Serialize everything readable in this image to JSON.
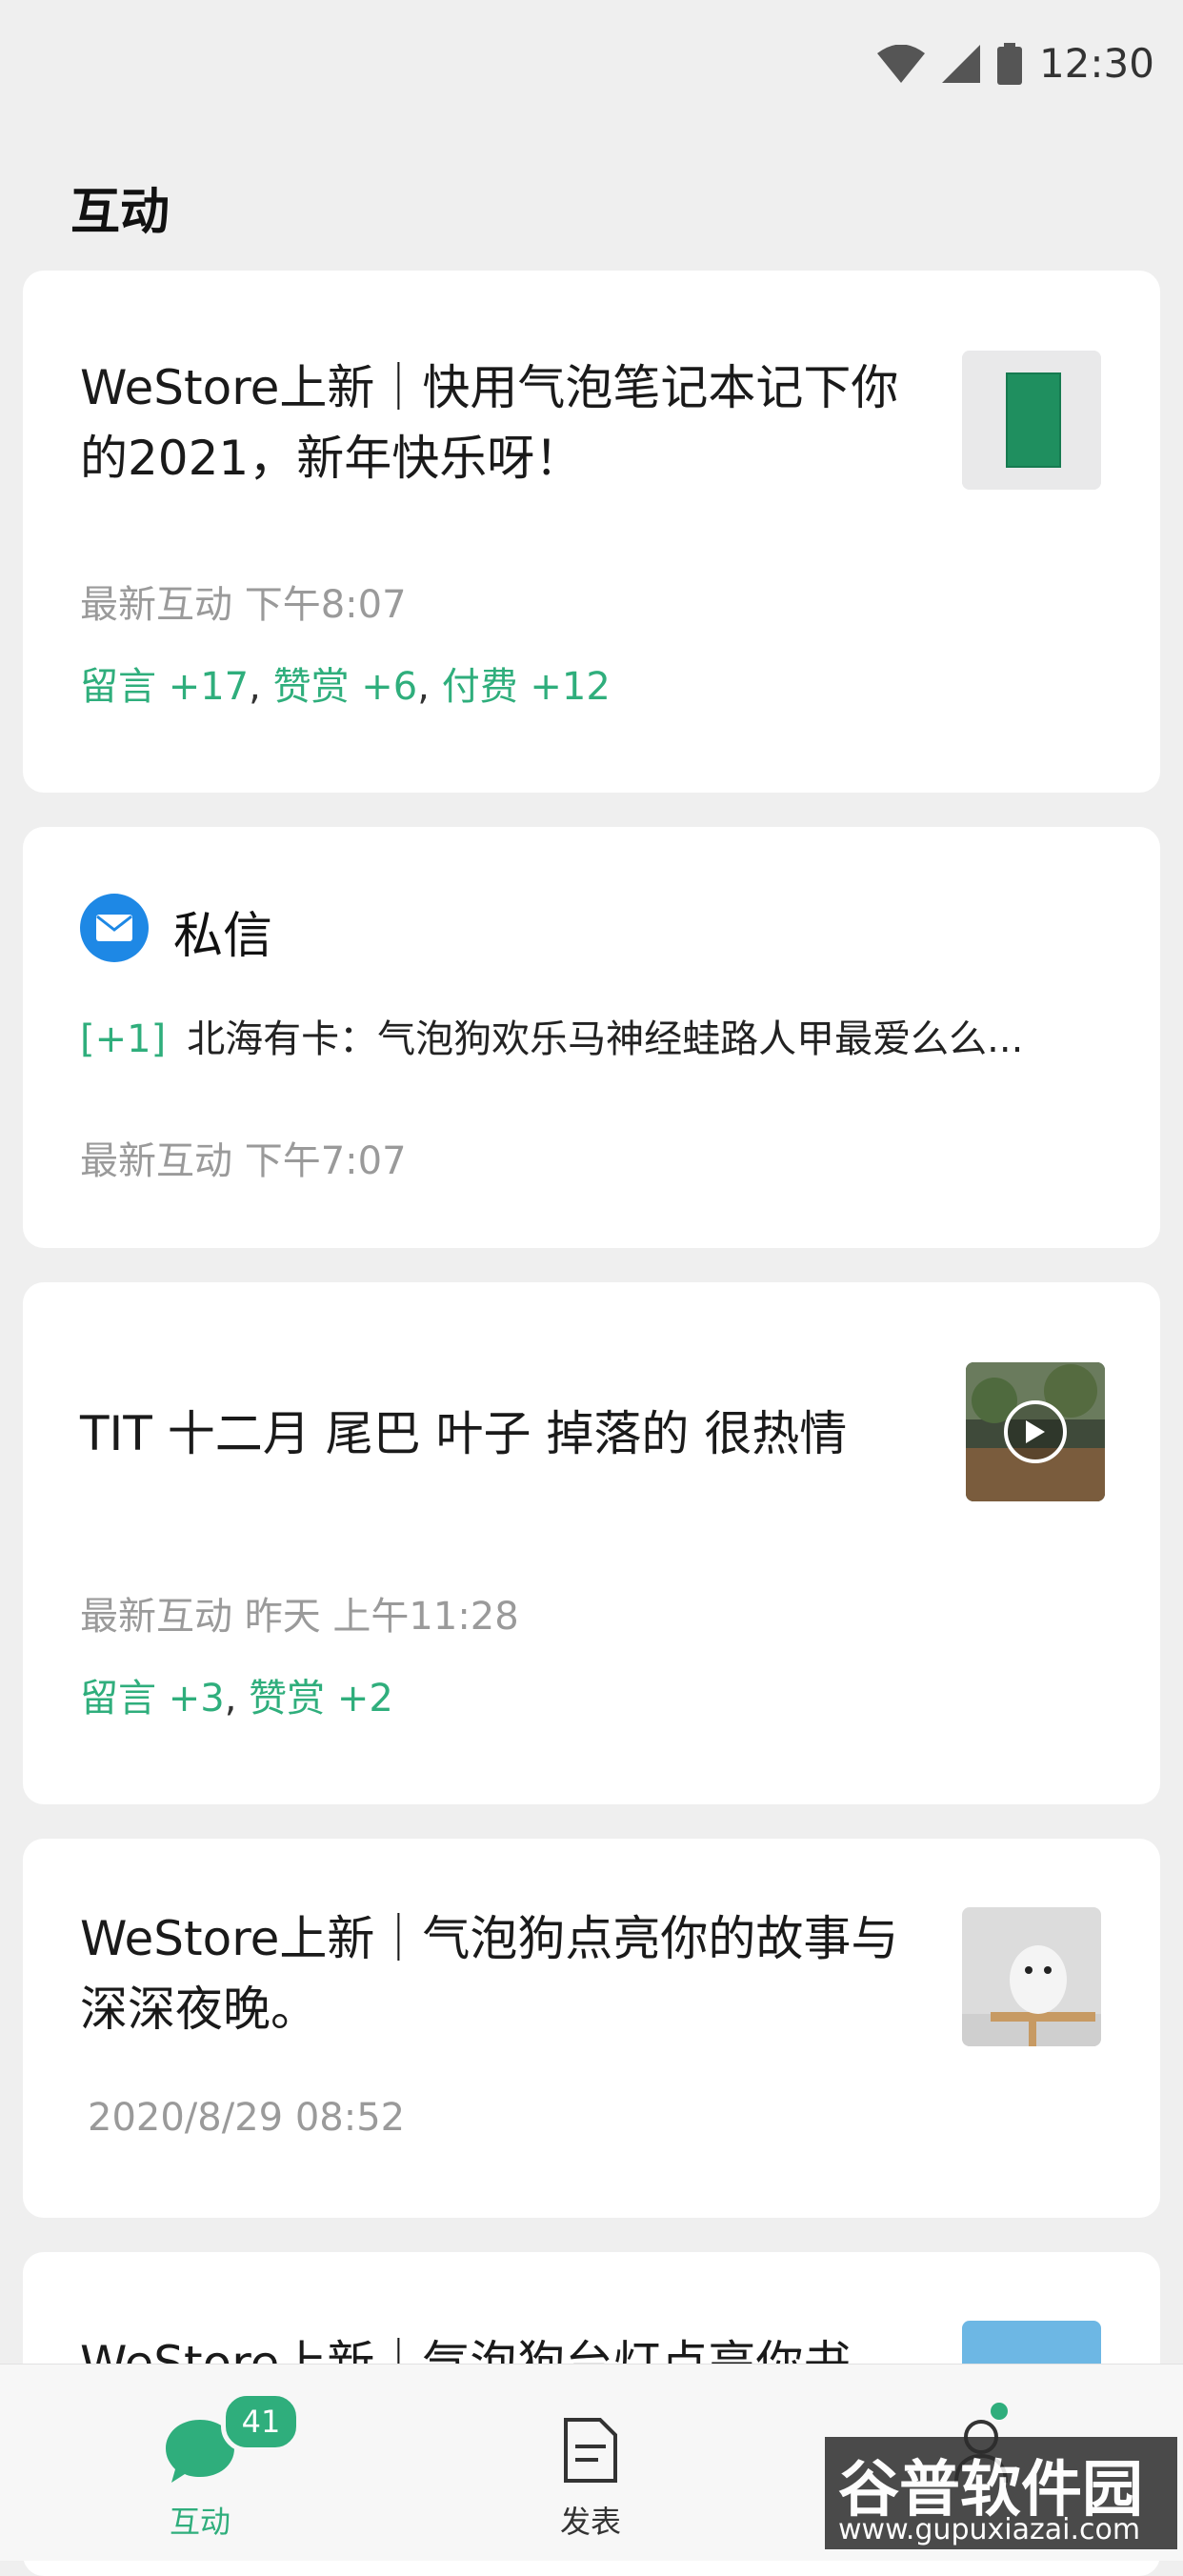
{
  "status_bar": {
    "time": "12:30"
  },
  "page": {
    "title": "互动"
  },
  "cards": [
    {
      "title": "WeStore上新｜快用气泡笔记本记下你的2021，新年快乐呀！",
      "meta": "最新互动  下午8:07",
      "stats": {
        "comment": "留言 +17",
        "reward": "赞赏 +6",
        "paid": "付费 +12",
        "sep1": ",",
        "sep2": ","
      }
    },
    {
      "title": "TIT 十二月 尾巴 叶子 掉落的 很热情",
      "meta": "最新互动 昨天 上午11:28",
      "stats": {
        "comment": "留言 +3",
        "reward": "赞赏 +2",
        "sep1": ","
      }
    },
    {
      "title": "WeStore上新｜气泡狗点亮你的故事与深深夜晚。",
      "meta": "2020/8/29  08:52"
    },
    {
      "title": "WeStore上新｜气泡狗台灯点亮你书"
    }
  ],
  "dm": {
    "title": "私信",
    "count": "[+1]",
    "preview": "北海有卡：气泡狗欢乐马神经蛙路人甲最爱么么...",
    "meta": "最新互动   下午7:07"
  },
  "tabbar": {
    "tabs": [
      {
        "label": "互动",
        "badge": "41"
      },
      {
        "label": "发表"
      }
    ],
    "active_color": "#2fae7c"
  },
  "watermark": {
    "main": "谷普软件园",
    "sub": "www.gupuxiazai.com"
  }
}
